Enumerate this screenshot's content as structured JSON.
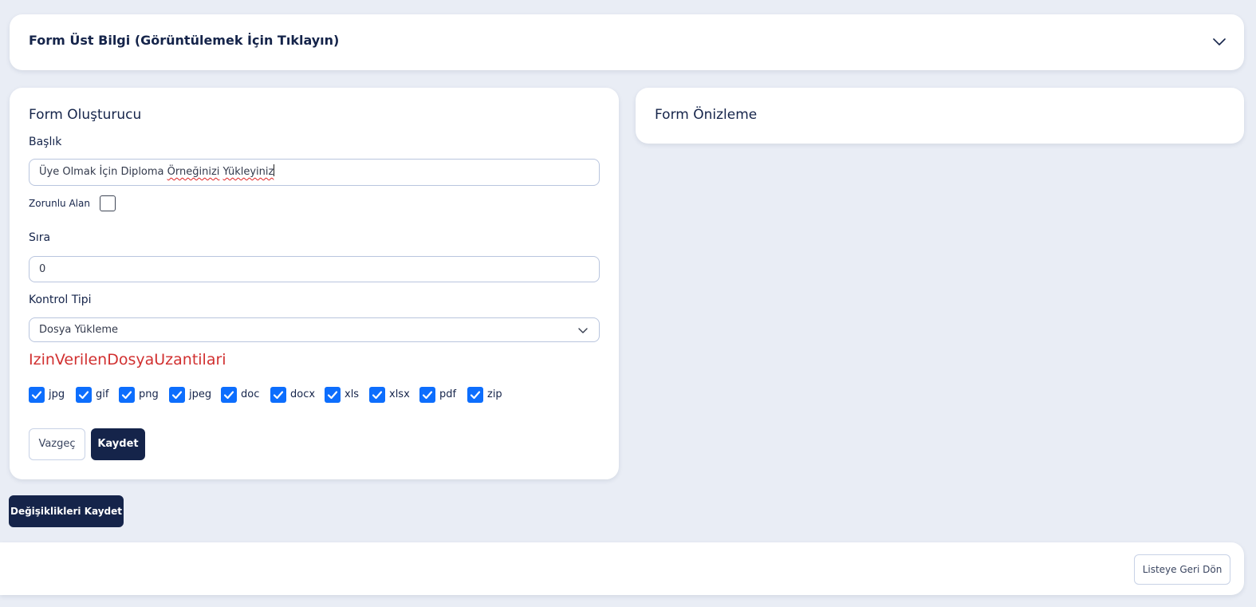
{
  "header": {
    "title": "Form Üst Bilgi (Görüntülemek İçin Tıklayın)"
  },
  "builder": {
    "title": "Form Oluşturucu",
    "title_label": "Başlık",
    "title_value_parts": [
      "Üye Olmak İçin Diploma ",
      "Örneğinizi",
      " ",
      "Yükleyiniz"
    ],
    "required_label": "Zorunlu Alan",
    "required_checked": false,
    "order_label": "Sıra",
    "order_value": "0",
    "control_type_label": "Kontrol Tipi",
    "control_type_value": "Dosya Yükleme",
    "extensions_heading": "IzinVerilenDosyaUzantilari",
    "extensions": [
      {
        "label": "jpg",
        "checked": true
      },
      {
        "label": "gif",
        "checked": true
      },
      {
        "label": "png",
        "checked": true
      },
      {
        "label": "jpeg",
        "checked": true
      },
      {
        "label": "doc",
        "checked": true
      },
      {
        "label": "docx",
        "checked": true
      },
      {
        "label": "xls",
        "checked": true
      },
      {
        "label": "xlsx",
        "checked": true
      },
      {
        "label": "pdf",
        "checked": true
      },
      {
        "label": "zip",
        "checked": true
      }
    ],
    "cancel_label": "Vazgeç",
    "save_label": "Kaydet"
  },
  "preview": {
    "title": "Form Önizleme"
  },
  "actions": {
    "save_changes_label": "Değişiklikleri Kaydet"
  },
  "footer": {
    "back_label": "Listeye Geri Dön"
  },
  "colors": {
    "primary": "#15244a",
    "checkbox": "#0d6efd",
    "error": "#d13030",
    "background": "#e9edf5"
  }
}
